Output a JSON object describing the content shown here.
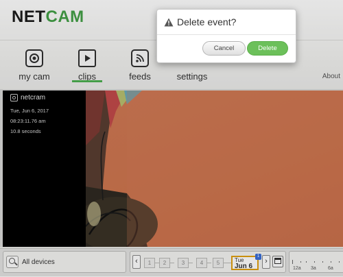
{
  "app": {
    "logo_part1": "NET",
    "logo_part2": "CAM",
    "brand_green": "#43a047"
  },
  "nav": {
    "items": [
      {
        "label": "my cam",
        "icon": "camera-icon",
        "active": false
      },
      {
        "label": "clips",
        "icon": "clips-play-icon",
        "active": true
      },
      {
        "label": "feeds",
        "icon": "rss-feed-icon",
        "active": false
      },
      {
        "label": "settings",
        "icon": "",
        "active": false
      }
    ],
    "about": "About"
  },
  "clip": {
    "camera_name": "netcram",
    "date": "Tue, Jun 6, 2017",
    "time": "08:23:11.76 am",
    "duration": "10.8 seconds"
  },
  "bottom": {
    "devices_label": "All devices",
    "prev_arrow": "‹",
    "next_arrow": "›",
    "days": [
      "1",
      "2",
      "3",
      "4",
      "5"
    ],
    "selected_day_weekday": "Tue",
    "selected_day_date": "Jun 6",
    "selected_day_badge": "1",
    "timeline_ticks": [
      "12a",
      "3a",
      "6a"
    ]
  },
  "modal": {
    "title": "Delete event?",
    "cancel_label": "Cancel",
    "delete_label": "Delete",
    "delete_color": "#6cc05a"
  }
}
